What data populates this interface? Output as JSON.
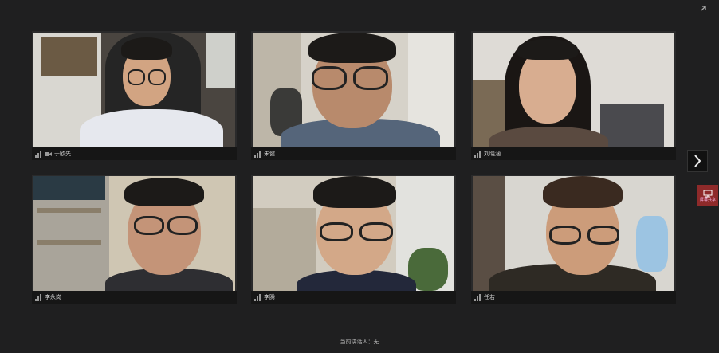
{
  "participants": [
    {
      "name": "于欧先"
    },
    {
      "name": "朱健"
    },
    {
      "name": "刘晓涵"
    },
    {
      "name": "李永岗"
    },
    {
      "name": "李腾"
    },
    {
      "name": "任若"
    }
  ],
  "footer": {
    "text": "当前讲话人：无"
  },
  "side_button": {
    "label": "屏幕共享"
  },
  "colors": {
    "background": "#1f1f20",
    "tile_bar": "#161616",
    "side_button": "#8e2a2a"
  }
}
